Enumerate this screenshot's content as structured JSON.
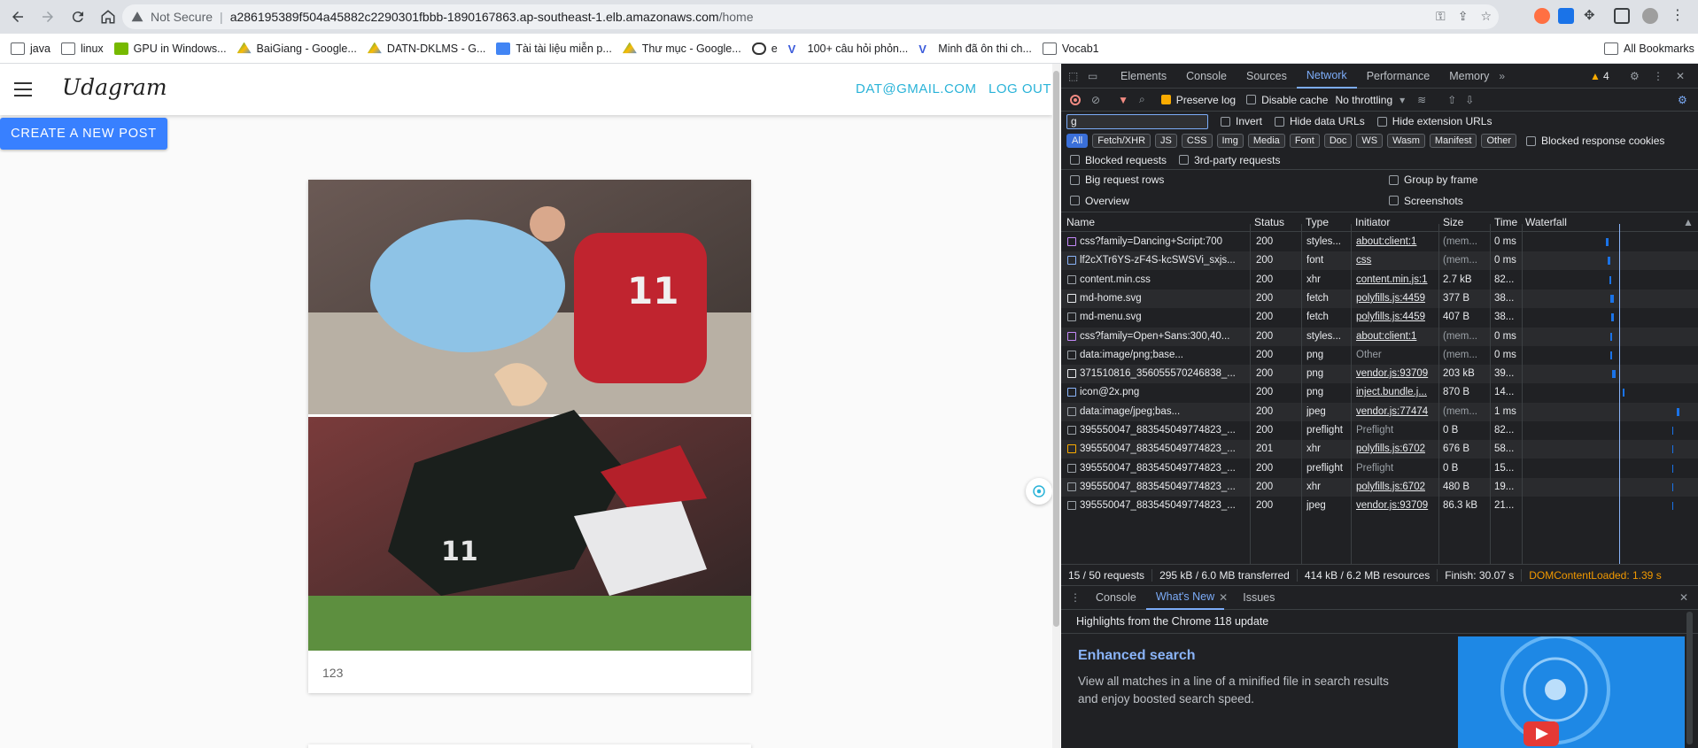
{
  "browser": {
    "not_secure": "Not Secure",
    "url_host": "a286195389f504a45882c2290301fbbb-1890167863.ap-southeast-1.elb.amazonaws.com",
    "url_path": "/home",
    "bookmarks": [
      "java",
      "linux",
      "GPU in Windows...",
      "BaiGiang - Google...",
      "DATN-DKLMS - G...",
      "Tài tài liệu miễn p...",
      "Thư mục - Google...",
      "e",
      "100+ câu hỏi phỏn...",
      "Minh đã ôn thi ch...",
      "Vocab1"
    ],
    "all_bookmarks": "All Bookmarks"
  },
  "app": {
    "logo": "Udagram",
    "user_email": "DAT@GMAIL.COM",
    "logout": "LOG OUT",
    "create_post": "CREATE A NEW POST",
    "post_caption": "123"
  },
  "devtools": {
    "tabs": [
      "Elements",
      "Console",
      "Sources",
      "Network",
      "Performance",
      "Memory"
    ],
    "issues_count": "4",
    "preserve_log": "Preserve log",
    "disable_cache": "Disable cache",
    "throttling": "No throttling",
    "filter_value": "g",
    "invert": "Invert",
    "hide_data_urls": "Hide data URLs",
    "hide_extension_urls": "Hide extension URLs",
    "type_filters": [
      "All",
      "Fetch/XHR",
      "JS",
      "CSS",
      "Img",
      "Media",
      "Font",
      "Doc",
      "WS",
      "Wasm",
      "Manifest",
      "Other"
    ],
    "blocked_response_cookies": "Blocked response cookies",
    "blocked_requests": "Blocked requests",
    "third_party": "3rd-party requests",
    "big_rows": "Big request rows",
    "group_by_frame": "Group by frame",
    "overview": "Overview",
    "screenshots": "Screenshots",
    "columns": [
      "Name",
      "Status",
      "Type",
      "Initiator",
      "Size",
      "Time",
      "Waterfall"
    ],
    "rows": [
      {
        "name": "css?family=Dancing+Script:700",
        "status": "200",
        "type": "styles...",
        "initiator": "about:client:1",
        "size": "(mem...",
        "time": "0 ms"
      },
      {
        "name": "lf2cXTr6YS-zF4S-kcSWSVi_sxjs...",
        "status": "200",
        "type": "font",
        "initiator": "css",
        "size": "(mem...",
        "time": "0 ms"
      },
      {
        "name": "content.min.css",
        "status": "200",
        "type": "xhr",
        "initiator": "content.min.js:1",
        "size": "2.7 kB",
        "time": "82..."
      },
      {
        "name": "md-home.svg",
        "status": "200",
        "type": "fetch",
        "initiator": "polyfills.js:4459",
        "size": "377 B",
        "time": "38..."
      },
      {
        "name": "md-menu.svg",
        "status": "200",
        "type": "fetch",
        "initiator": "polyfills.js:4459",
        "size": "407 B",
        "time": "38..."
      },
      {
        "name": "css?family=Open+Sans:300,40...",
        "status": "200",
        "type": "styles...",
        "initiator": "about:client:1",
        "size": "(mem...",
        "time": "0 ms"
      },
      {
        "name": "data:image/png;base...",
        "status": "200",
        "type": "png",
        "initiator": "Other",
        "size": "(mem...",
        "time": "0 ms"
      },
      {
        "name": "371510816_356055570246838_...",
        "status": "200",
        "type": "png",
        "initiator": "vendor.js:93709",
        "size": "203 kB",
        "time": "39..."
      },
      {
        "name": "icon@2x.png",
        "status": "200",
        "type": "png",
        "initiator": "inject.bundle.j...",
        "size": "870 B",
        "time": "14..."
      },
      {
        "name": "data:image/jpeg;bas...",
        "status": "200",
        "type": "jpeg",
        "initiator": "vendor.js:77474",
        "size": "(mem...",
        "time": "1 ms"
      },
      {
        "name": "395550047_883545049774823_...",
        "status": "200",
        "type": "preflight",
        "initiator": "Preflight",
        "size": "0 B",
        "time": "82..."
      },
      {
        "name": "395550047_883545049774823_...",
        "status": "201",
        "type": "xhr",
        "initiator": "polyfills.js:6702",
        "size": "676 B",
        "time": "58..."
      },
      {
        "name": "395550047_883545049774823_...",
        "status": "200",
        "type": "preflight",
        "initiator": "Preflight",
        "size": "0 B",
        "time": "15..."
      },
      {
        "name": "395550047_883545049774823_...",
        "status": "200",
        "type": "xhr",
        "initiator": "polyfills.js:6702",
        "size": "480 B",
        "time": "19..."
      },
      {
        "name": "395550047_883545049774823_...",
        "status": "200",
        "type": "jpeg",
        "initiator": "vendor.js:93709",
        "size": "86.3 kB",
        "time": "21..."
      }
    ],
    "summary": {
      "requests": "15 / 50 requests",
      "transferred": "295 kB / 6.0 MB transferred",
      "resources": "414 kB / 6.2 MB resources",
      "finish": "Finish: 30.07 s",
      "dcl": "DOMContentLoaded: 1.39 s"
    },
    "drawer_tabs": [
      "Console",
      "What's New",
      "Issues"
    ],
    "whats_new": {
      "highlights": "Highlights from the Chrome 118 update",
      "heading": "Enhanced search",
      "body": "View all matches in a line of a minified file in search results and enjoy boosted search speed."
    }
  }
}
